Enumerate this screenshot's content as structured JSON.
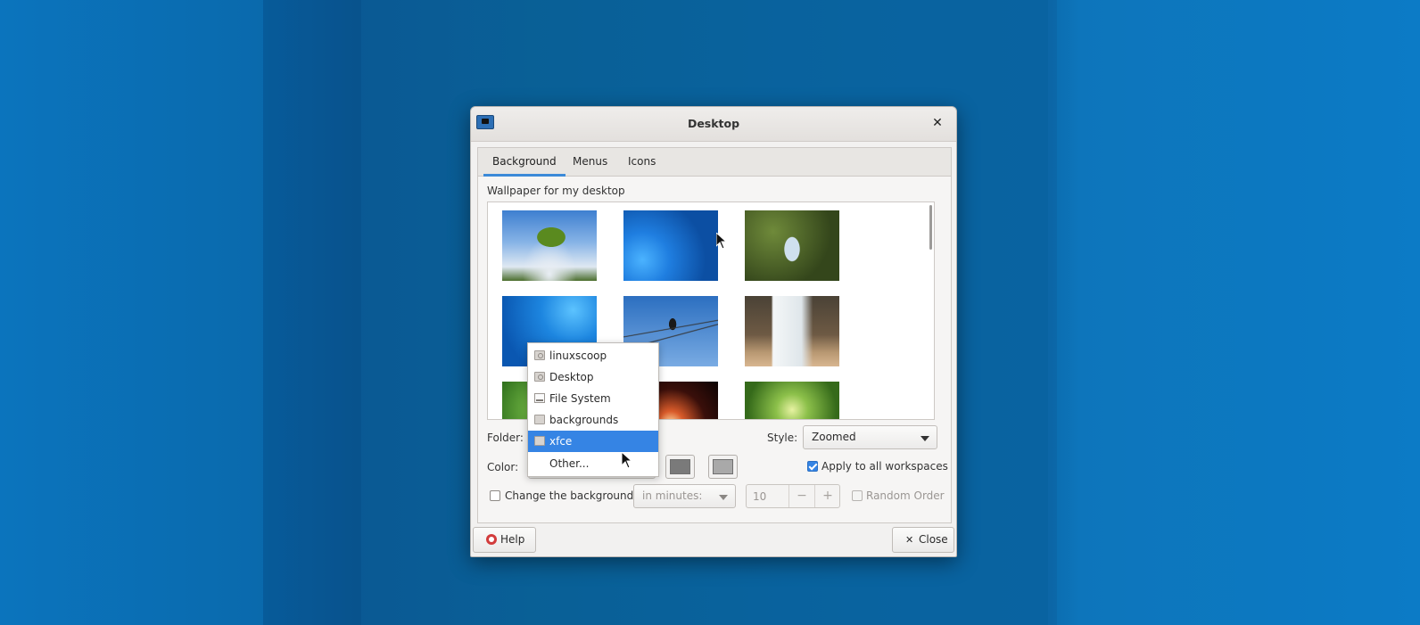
{
  "window": {
    "title": "Desktop"
  },
  "tabs": [
    {
      "label": "Background",
      "active": true
    },
    {
      "label": "Menus",
      "active": false
    },
    {
      "label": "Icons",
      "active": false
    }
  ],
  "background": {
    "section_label": "Wallpaper for my desktop",
    "wallpapers": [
      {
        "name": "clover-sky"
      },
      {
        "name": "blue-abstract-1"
      },
      {
        "name": "butterfly"
      },
      {
        "name": "blue-abstract-2"
      },
      {
        "name": "bird-on-wire"
      },
      {
        "name": "waterfall"
      },
      {
        "name": "green-leaf"
      },
      {
        "name": "fireworks"
      },
      {
        "name": "forest"
      }
    ],
    "folder_label": "Folder:",
    "style_label": "Style:",
    "style_value": "Zoomed",
    "color_label": "Color:",
    "apply_all_label": "Apply to all workspaces",
    "apply_all_checked": true,
    "change_bg_label": "Change the background",
    "change_bg_checked": false,
    "interval_unit": "in minutes:",
    "interval_value": "10",
    "spin_minus": "−",
    "spin_plus": "+",
    "random_order_label": "Random Order",
    "random_order_checked": false,
    "color1": "#7a7a7a",
    "color2": "#a9a9a9"
  },
  "folder_popup": {
    "items": [
      {
        "label": "linuxscoop",
        "icon": "home-folder-icon"
      },
      {
        "label": "Desktop",
        "icon": "desktop-folder-icon"
      },
      {
        "label": "File System",
        "icon": "drive-icon"
      },
      {
        "label": "backgrounds",
        "icon": "folder-icon"
      },
      {
        "label": "xfce",
        "icon": "folder-icon",
        "selected": true
      },
      {
        "label": "Other...",
        "icon": ""
      }
    ]
  },
  "buttons": {
    "help": "Help",
    "close": "Close",
    "close_glyph": "✕"
  },
  "colors": {
    "accent": "#3584e4",
    "desktop": "#0a6fb8"
  }
}
